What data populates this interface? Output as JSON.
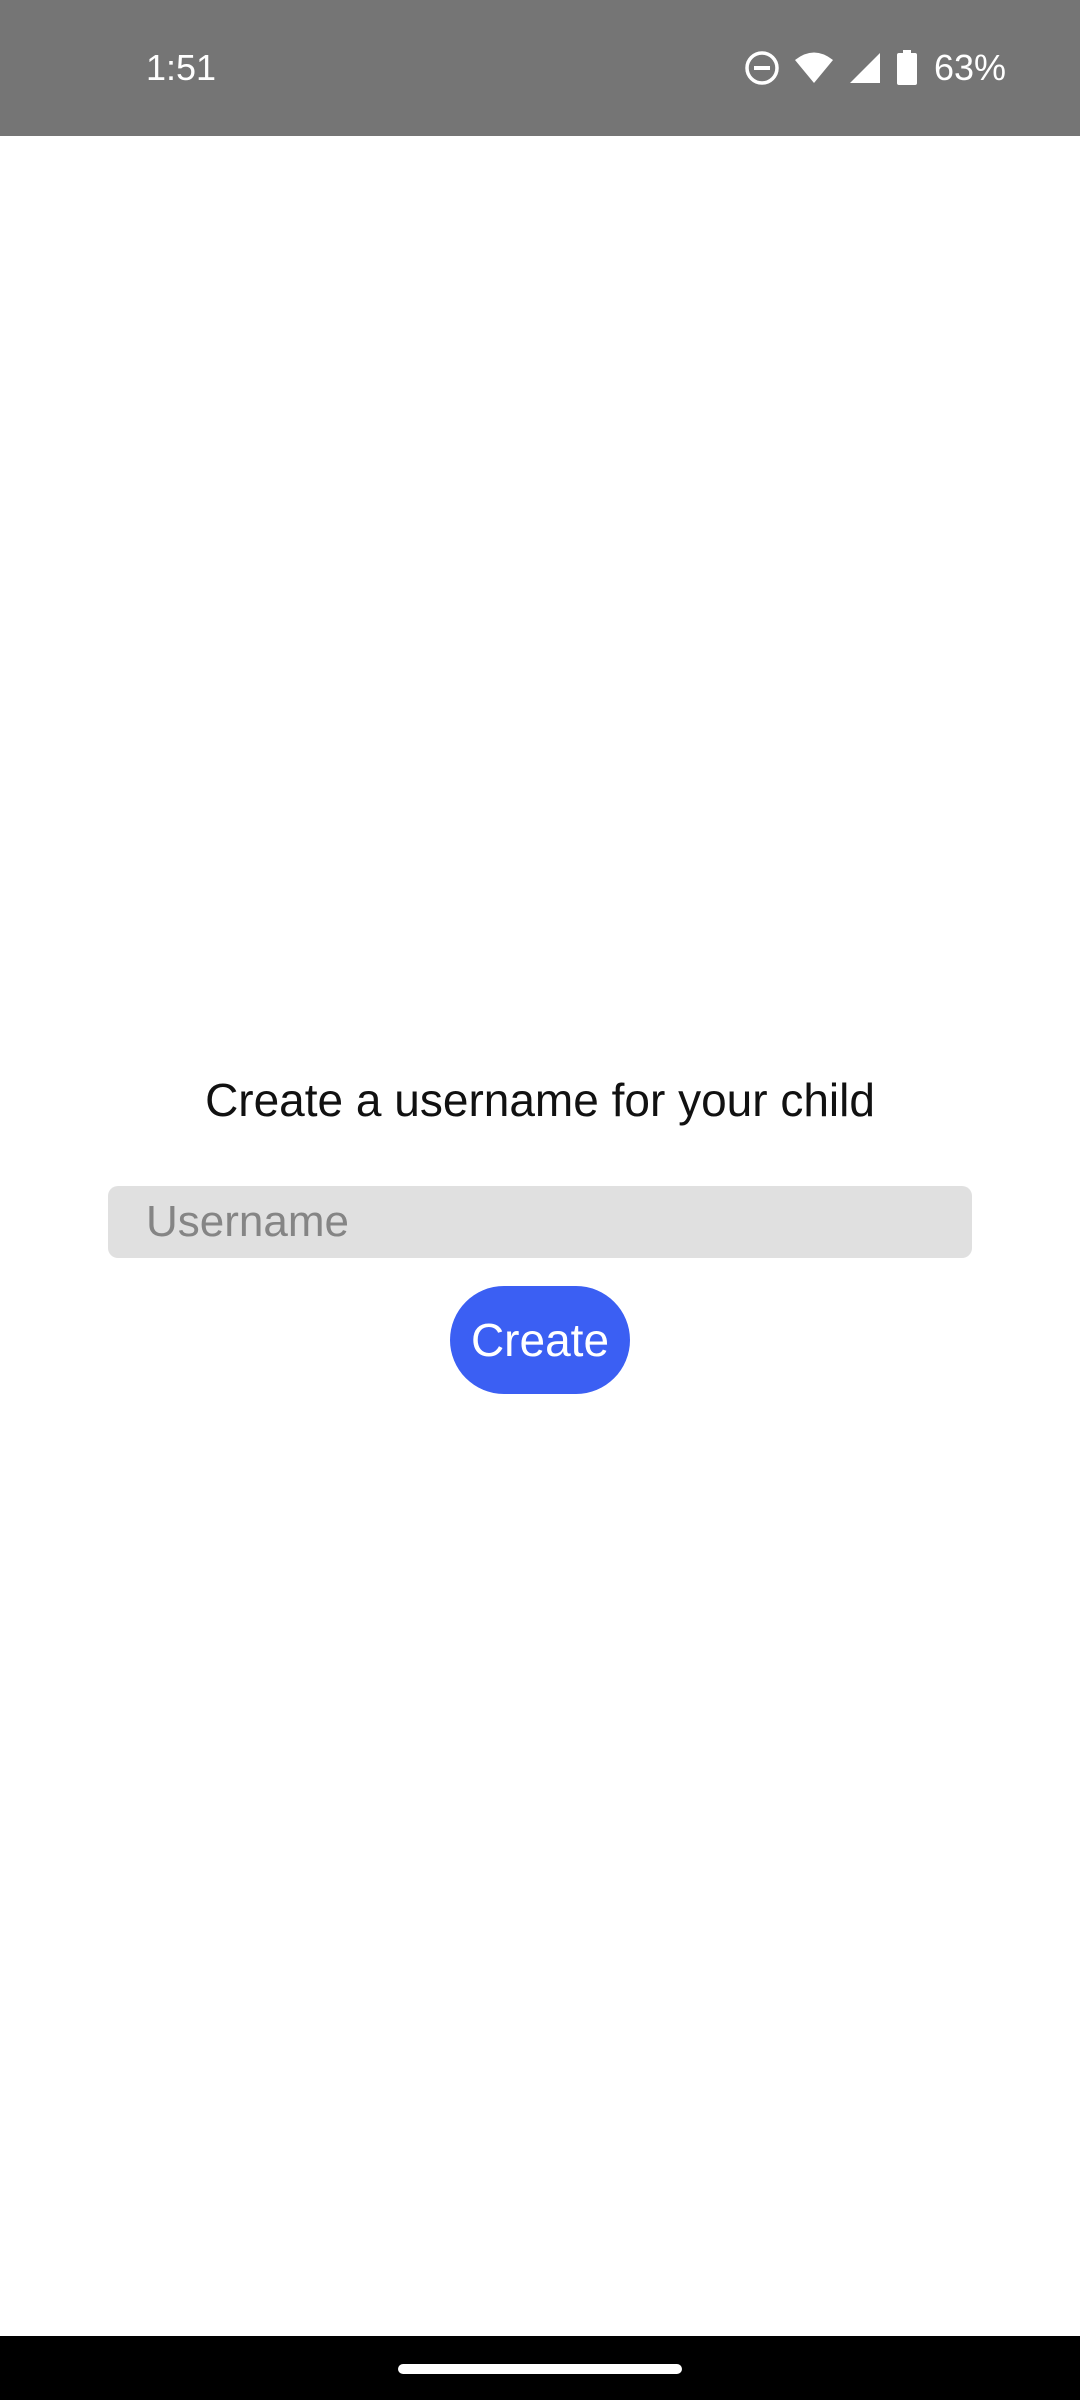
{
  "status_bar": {
    "time": "1:51",
    "battery_percent": "63%",
    "icons": [
      "do-not-disturb-icon",
      "wifi-icon",
      "cellular-signal-icon",
      "battery-icon"
    ],
    "background_color": "#757575"
  },
  "screen": {
    "prompt": "Create a username for your child",
    "username_input": {
      "placeholder": "Username",
      "value": ""
    },
    "create_button": {
      "label": "Create",
      "color": "#3b5ff3"
    }
  },
  "navigation_bar": {
    "handle_icon": "home-gesture-handle"
  }
}
